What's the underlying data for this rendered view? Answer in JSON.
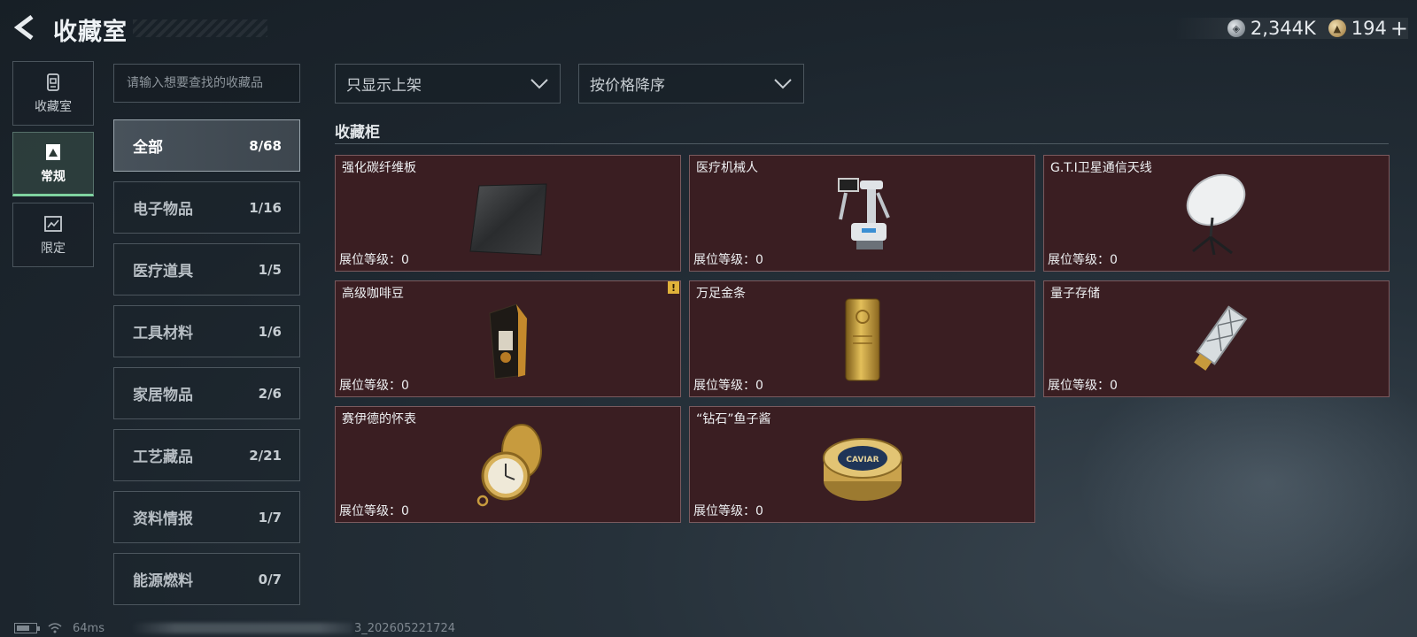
{
  "header": {
    "title": "收藏室",
    "currencies": [
      {
        "icon": "silver-coin-icon",
        "value": "2,344K"
      },
      {
        "icon": "gold-coin-icon",
        "value": "194"
      }
    ],
    "add_label": "+"
  },
  "side_nav": [
    {
      "label": "收藏室",
      "icon": "collection-room-icon",
      "active": false
    },
    {
      "label": "常规",
      "icon": "regular-icon",
      "active": true
    },
    {
      "label": "限定",
      "icon": "limited-icon",
      "active": false
    }
  ],
  "search": {
    "placeholder": "请输入想要查找的收藏品"
  },
  "categories": [
    {
      "name": "全部",
      "count": "8/68",
      "active": true
    },
    {
      "name": "电子物品",
      "count": "1/16"
    },
    {
      "name": "医疗道具",
      "count": "1/5"
    },
    {
      "name": "工具材料",
      "count": "1/6"
    },
    {
      "name": "家居物品",
      "count": "2/6"
    },
    {
      "name": "工艺藏品",
      "count": "2/21"
    },
    {
      "name": "资料情报",
      "count": "1/7"
    },
    {
      "name": "能源燃料",
      "count": "0/7"
    }
  ],
  "filters": {
    "listing": "只显示上架",
    "sort": "按价格降序"
  },
  "section_title": "收藏柜",
  "items": [
    {
      "name": "强化碳纤维板",
      "level": "展位等级：0",
      "icon": "carbon-fiber-plate-icon"
    },
    {
      "name": "医疗机械人",
      "level": "展位等级：0",
      "icon": "medical-robot-icon"
    },
    {
      "name": "G.T.I卫星通信天线",
      "level": "展位等级：0",
      "icon": "satellite-antenna-icon"
    },
    {
      "name": "高级咖啡豆",
      "level": "展位等级：0",
      "icon": "coffee-beans-icon",
      "warning": "!"
    },
    {
      "name": "万足金条",
      "level": "展位等级：0",
      "icon": "gold-bar-icon"
    },
    {
      "name": "量子存储",
      "level": "展位等级：0",
      "icon": "quantum-storage-icon"
    },
    {
      "name": "赛伊德的怀表",
      "level": "展位等级：0",
      "icon": "pocket-watch-icon"
    },
    {
      "name": "“钻石”鱼子酱",
      "level": "展位等级：0",
      "icon": "caviar-tin-icon",
      "tin_label": "CAVIAR"
    }
  ],
  "status": {
    "ping": "64ms",
    "build": "3_202605221724"
  }
}
